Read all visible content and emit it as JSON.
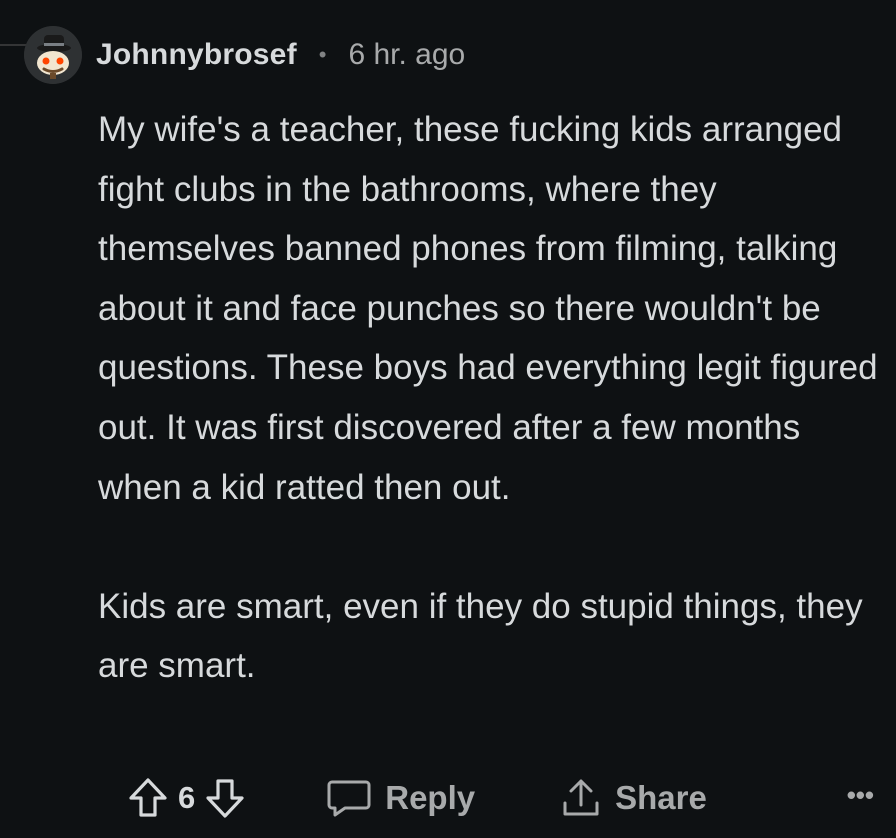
{
  "comment": {
    "author": "Johnnybrosef",
    "separator": "•",
    "timestamp": "6 hr. ago",
    "paragraphs": [
      "My wife's a teacher, these fucking kids arranged fight clubs in the bathrooms, where they themselves banned phones from filming, talking about it and face punches so there wouldn't be questions. These boys had everything legit figured out. It was first discovered after a few months when a kid ratted then out.",
      "Kids are smart, even if they do stupid things, they are smart."
    ],
    "score": "6"
  },
  "actions": {
    "reply_label": "Reply",
    "share_label": "Share",
    "more_label": "•••"
  },
  "icons": {
    "upvote": "arrow-up-icon",
    "downvote": "arrow-down-icon",
    "reply": "speech-bubble-icon",
    "share": "share-upload-icon",
    "more": "ellipsis-icon",
    "avatar": "snoo-avatar-with-hat"
  },
  "colors": {
    "background": "#0e1113",
    "text": "#d7dadc",
    "muted": "#a8aaab"
  }
}
